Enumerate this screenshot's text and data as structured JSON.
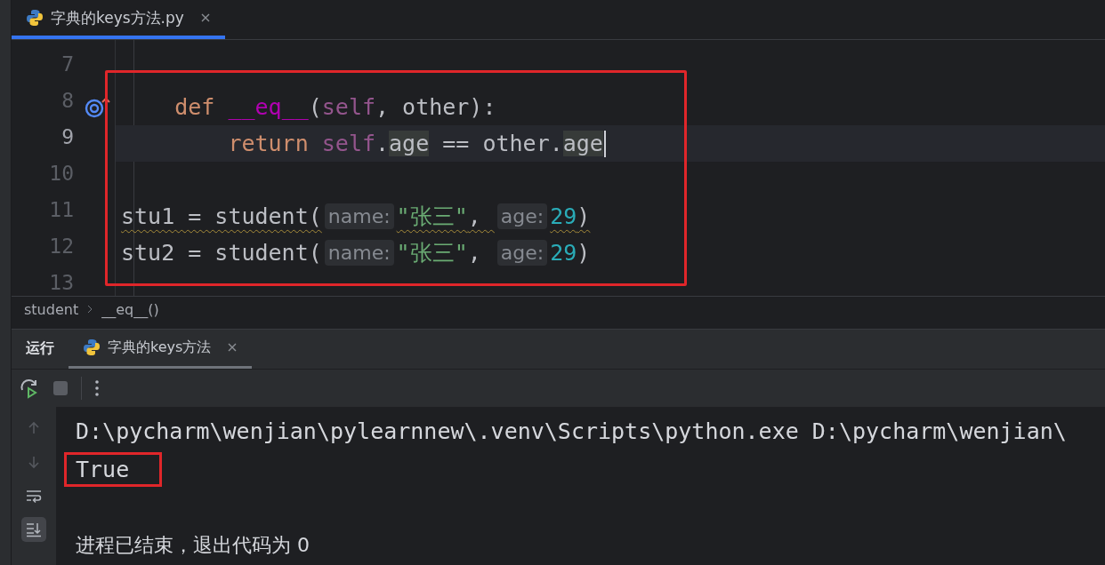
{
  "editor_tabs": [
    {
      "label": "字典的keys方法.py",
      "selected": true
    }
  ],
  "code": {
    "lines": [
      {
        "number": "7",
        "current": false,
        "caret": false
      },
      {
        "number": "8",
        "current": false,
        "warn": false,
        "caret": false,
        "override_marker": true,
        "tokens": [
          {
            "text": "    def ",
            "kind": "keyword"
          },
          {
            "text": "__eq__",
            "kind": "function"
          },
          {
            "text": "(",
            "kind": "plain"
          },
          {
            "text": "self",
            "kind": "self"
          },
          {
            "text": ", other):",
            "kind": "plain"
          }
        ]
      },
      {
        "number": "9",
        "current": true,
        "warn": false,
        "caret": true,
        "tokens": [
          {
            "text": "        return ",
            "kind": "keyword"
          },
          {
            "text": "self",
            "kind": "self"
          },
          {
            "text": ".",
            "kind": "plain"
          },
          {
            "text": "age",
            "kind": "field"
          },
          {
            "text": " == other.",
            "kind": "plain"
          },
          {
            "text": "age",
            "kind": "field"
          }
        ]
      },
      {
        "number": "10",
        "current": false,
        "caret": false
      },
      {
        "number": "11",
        "current": false,
        "warn": true,
        "caret": false,
        "tokens": [
          {
            "text": "stu1 = student(",
            "kind": "plain"
          },
          {
            "text": "name:",
            "kind": "hint"
          },
          {
            "text": "\"张三\"",
            "kind": "string"
          },
          {
            "text": ", ",
            "kind": "plain"
          },
          {
            "text": "age:",
            "kind": "hint"
          },
          {
            "text": "29",
            "kind": "number"
          },
          {
            "text": ")",
            "kind": "plain"
          }
        ]
      },
      {
        "number": "12",
        "current": false,
        "warn": false,
        "caret": false,
        "tokens": [
          {
            "text": "stu2 = student(",
            "kind": "plain"
          },
          {
            "text": "name:",
            "kind": "hint"
          },
          {
            "text": "\"张三\"",
            "kind": "string"
          },
          {
            "text": ", ",
            "kind": "plain"
          },
          {
            "text": "age:",
            "kind": "hint"
          },
          {
            "text": "29",
            "kind": "number"
          },
          {
            "text": ")",
            "kind": "plain"
          }
        ]
      },
      {
        "number": "13",
        "current": false,
        "caret": false
      }
    ]
  },
  "breadcrumbs": [
    "student",
    "__eq__()"
  ],
  "run_panel": {
    "title": "运行",
    "tabs": [
      {
        "label": "字典的keys方法",
        "selected": true
      }
    ],
    "side_tools": [
      {
        "kind": "up",
        "disabled": true,
        "on": false
      },
      {
        "kind": "down",
        "disabled": true,
        "on": false
      },
      {
        "kind": "wrap",
        "disabled": false,
        "on": false
      },
      {
        "kind": "scroll-end",
        "disabled": false,
        "on": true
      }
    ],
    "output": [
      {
        "text": "D:\\pycharm\\wenjian\\pylearnnew\\.venv\\Scripts\\python.exe D:\\pycharm\\wenjian\\",
        "highlighted": false
      },
      {
        "text": "True",
        "highlighted": true
      },
      {
        "text": "进程已结束，退出代码为 0",
        "highlighted": false
      }
    ]
  }
}
